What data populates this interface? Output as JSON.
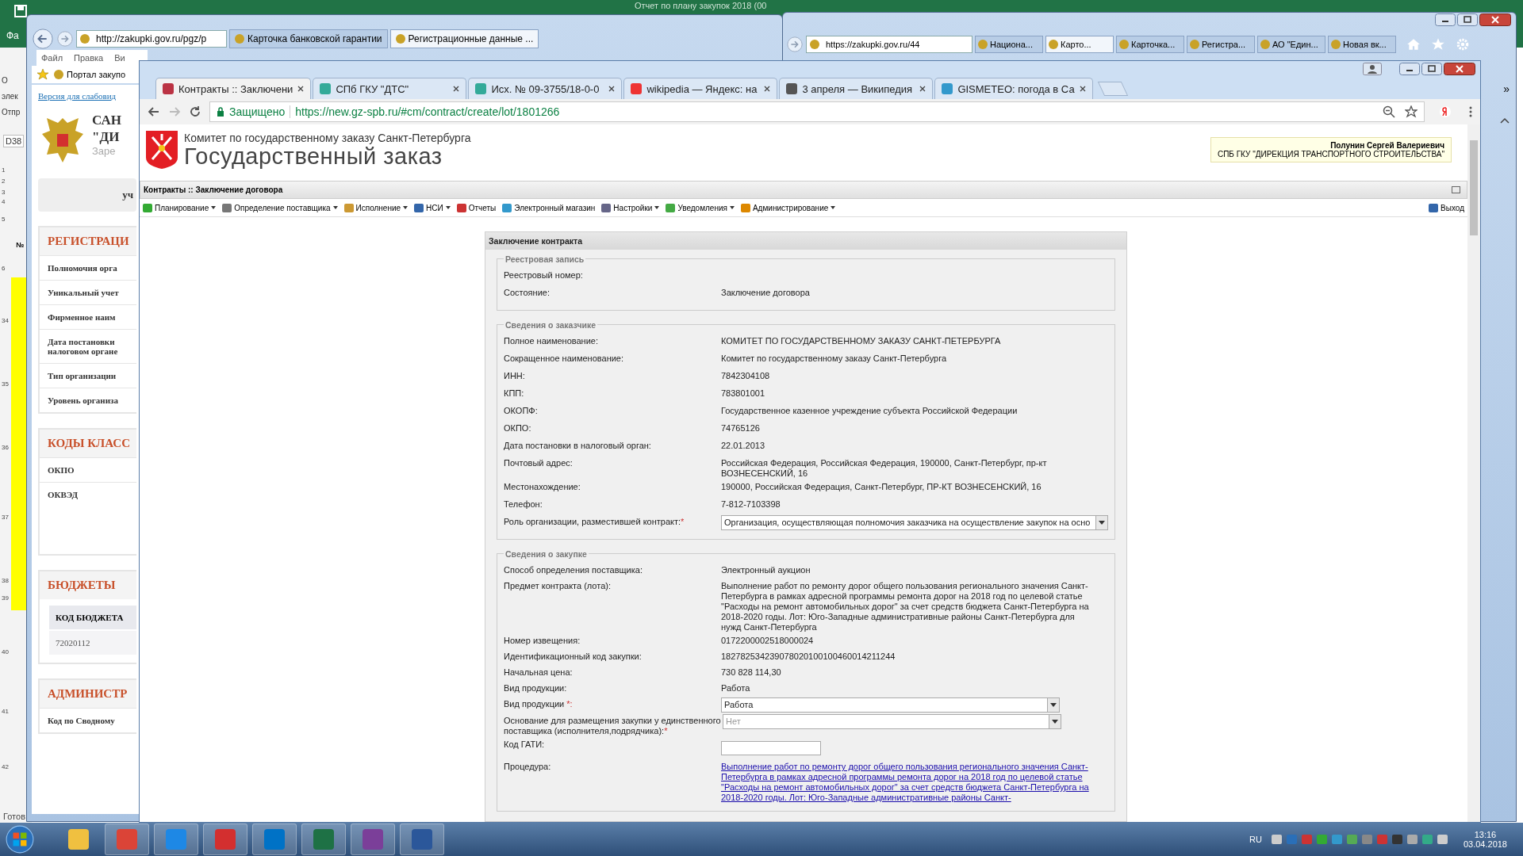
{
  "excel": {
    "title": "Отчет по плану закупок 2018 (00",
    "file_tab": "Фа",
    "side_texts": [
      "О",
      "элек",
      "Отпр"
    ],
    "cell_ref": "D38",
    "header_mark": "№",
    "row_numbers": [
      "1",
      "2",
      "3",
      "4",
      "5",
      "6",
      "34",
      "35",
      "36",
      "37",
      "38",
      "39",
      "40",
      "41",
      "42"
    ],
    "status": "Готов"
  },
  "ie_left": {
    "address": "http://zakupki.gov.ru/pgz/p",
    "tabs": [
      {
        "label": "Карточка банковской гарантии",
        "selected": false
      },
      {
        "label": "Регистрационные данные ...",
        "selected": true
      }
    ],
    "menu": [
      "Файл",
      "Правка",
      "Ви"
    ],
    "favorite": "Портал закупо",
    "page": {
      "accessibility_link": "Версия для слабовид",
      "org_title_lines": [
        "САН",
        "\"ДИ"
      ],
      "subtitle": "Заре",
      "button": "уч",
      "sections": [
        {
          "heading": "РЕГИСТРАЦИ",
          "rows": [
            "Полномочия орга",
            "Уникальный учет",
            "Фирменное наим",
            "Дата постановки\nналоговом органе",
            "Тип организации",
            "Уровень организа"
          ]
        },
        {
          "heading": "КОДЫ КЛАСС",
          "rows": [
            "ОКПО",
            "ОКВЭД"
          ]
        },
        {
          "heading": "БЮДЖЕТЫ",
          "table": {
            "column": "КОД БЮДЖЕТА",
            "cell": "72020112"
          }
        },
        {
          "heading": "АДМИНИСТР",
          "rows": [
            "Код по Сводному"
          ]
        }
      ]
    }
  },
  "ie_right": {
    "address": "https://zakupki.gov.ru/44",
    "tabs": [
      {
        "label": "Национа...",
        "selected": false
      },
      {
        "label": "Карто...",
        "selected": true
      },
      {
        "label": "Карточка...",
        "selected": false
      },
      {
        "label": "Регистра...",
        "selected": false
      },
      {
        "label": "АО \"Един...",
        "selected": false
      },
      {
        "label": "Новая вк...",
        "selected": false
      }
    ],
    "overflow": "»"
  },
  "chrome": {
    "tabs": [
      {
        "label": "Контракты :: Заключени",
        "selected": true
      },
      {
        "label": "СПб ГКУ \"ДТС\"",
        "selected": false
      },
      {
        "label": "Исх. № 09-3755/18-0-0",
        "selected": false
      },
      {
        "label": "wikipedia — Яндекс: на",
        "selected": false
      },
      {
        "label": "3 апреля — Википедия",
        "selected": false
      },
      {
        "label": "GISMETEO: погода в Са",
        "selected": false
      }
    ],
    "security": "Защищено",
    "url": "https://new.gz-spb.ru/#cm/contract/create/lot/1801266"
  },
  "page": {
    "committee": "Комитет по государственному заказу Санкт-Петербурга",
    "title": "Государственный заказ",
    "user_name": "Полунин Сергей Валериевич",
    "user_org": "СПБ ГКУ \"ДИРЕКЦИЯ ТРАНСПОРТНОГО СТРОИТЕЛЬСТВА\"",
    "breadcrumb": "Контракты :: Заключение договора",
    "menu": [
      {
        "label": "Планирование",
        "dropdown": true
      },
      {
        "label": "Определение поставщика",
        "dropdown": true
      },
      {
        "label": "Исполнение",
        "dropdown": true
      },
      {
        "label": "НСИ",
        "dropdown": true
      },
      {
        "label": "Отчеты",
        "dropdown": false
      },
      {
        "label": "Электронный магазин",
        "dropdown": false
      },
      {
        "label": "Настройки",
        "dropdown": true
      },
      {
        "label": "Уведомления",
        "dropdown": true
      },
      {
        "label": "Администрирование",
        "dropdown": true
      }
    ],
    "logout": "Выход",
    "form": {
      "title": "Заключение контракта",
      "fieldsets": [
        {
          "legend": "Реестровая запись",
          "rows": [
            {
              "kind": "text",
              "label": "Реестровый номер:"
            },
            {
              "kind": "text",
              "label": "Состояние:",
              "value": "Заключение договора"
            }
          ]
        },
        {
          "legend": "Сведения о заказчике",
          "rows": [
            {
              "kind": "text",
              "label": "Полное наименование:",
              "value": "КОМИТЕТ ПО ГОСУДАРСТВЕННОМУ ЗАКАЗУ САНКТ-ПЕТЕРБУРГА"
            },
            {
              "kind": "text",
              "label": "Сокращенное наименование:",
              "value": "Комитет по государственному заказу Санкт-Петербурга"
            },
            {
              "kind": "text",
              "label": "ИНН:",
              "value": "7842304108"
            },
            {
              "kind": "text",
              "label": "КПП:",
              "value": "783801001"
            },
            {
              "kind": "text",
              "label": "ОКОПФ:",
              "value": "Государственное казенное учреждение субъекта Российской Федерации"
            },
            {
              "kind": "text",
              "label": "ОКПО:",
              "value": "74765126"
            },
            {
              "kind": "text",
              "label": "Дата постановки в налоговый орган:",
              "value": "22.01.2013"
            },
            {
              "kind": "text",
              "label": "Почтовый адрес:",
              "value": "Российская Федерация, Российская Федерация, 190000, Санкт-Петербург, пр-кт ВОЗНЕСЕНСКИЙ, 16"
            },
            {
              "kind": "text",
              "label": "Местонахождение:",
              "value": "190000, Российская Федерация, Санкт-Петербург, ПР-КТ ВОЗНЕСЕНСКИЙ, 16"
            },
            {
              "kind": "text",
              "label": "Телефон:",
              "value": "7-812-7103398"
            },
            {
              "kind": "select",
              "label": "Роль организации, разместившей контракт:",
              "required_mark": "*",
              "value": "Организация, осуществляющая полномочия заказчика на осуществление закупок на осно",
              "disabled": false
            }
          ]
        },
        {
          "legend": "Сведения о закупке",
          "rows": [
            {
              "kind": "text",
              "label": "Способ определения поставщика:",
              "value": "Электронный аукцион"
            },
            {
              "kind": "text",
              "label": "Предмет контракта (лота):",
              "value": "Выполнение работ по ремонту дорог общего пользования регионального значения Санкт-Петербурга в рамках адресной программы ремонта дорог на 2018 год по целевой статье \"Расходы на ремонт автомобильных дорог\" за счет средств бюджета Санкт-Петербурга на 2018-2020 годы. Лот: Юго-Западные административные районы Санкт-Петербурга для нужд Санкт-Петербурга"
            },
            {
              "kind": "text",
              "label": "Номер извещения:",
              "value": "0172200002518000024"
            },
            {
              "kind": "text",
              "label": "Идентификационный код закупки:",
              "value": "182782534239078020100100460014211244"
            },
            {
              "kind": "text",
              "label": "Начальная цена:",
              "value": "730 828 114,30"
            },
            {
              "kind": "text",
              "label": "Вид продукции:",
              "value": "Работа"
            },
            {
              "kind": "select",
              "label": "Вид продукции ",
              "required_mark": "*:",
              "value": "Работа",
              "disabled": false
            },
            {
              "kind": "select",
              "label": "Основание для размещения закупки у единственного поставщика (исполнителя,подрядчика):",
              "required_mark": "*",
              "value": "Нет",
              "disabled": true
            },
            {
              "kind": "input",
              "label": "Код ГАТИ:"
            },
            {
              "kind": "link",
              "label": "Процедура:",
              "value": "Выполнение работ по ремонту дорог общего пользования регионального значения Санкт-Петербурга в рамках адресной программы ремонта дорог на 2018 год по целевой статье \"Расходы на ремонт автомобильных дорог\" за счет средств бюджета Санкт-Петербурга на 2018-2020 годы. Лот: Юго-Западные административные районы Санкт-"
            }
          ]
        }
      ]
    }
  },
  "taskbar": {
    "language": "RU",
    "time": "13:16",
    "date": "03.04.2018"
  }
}
